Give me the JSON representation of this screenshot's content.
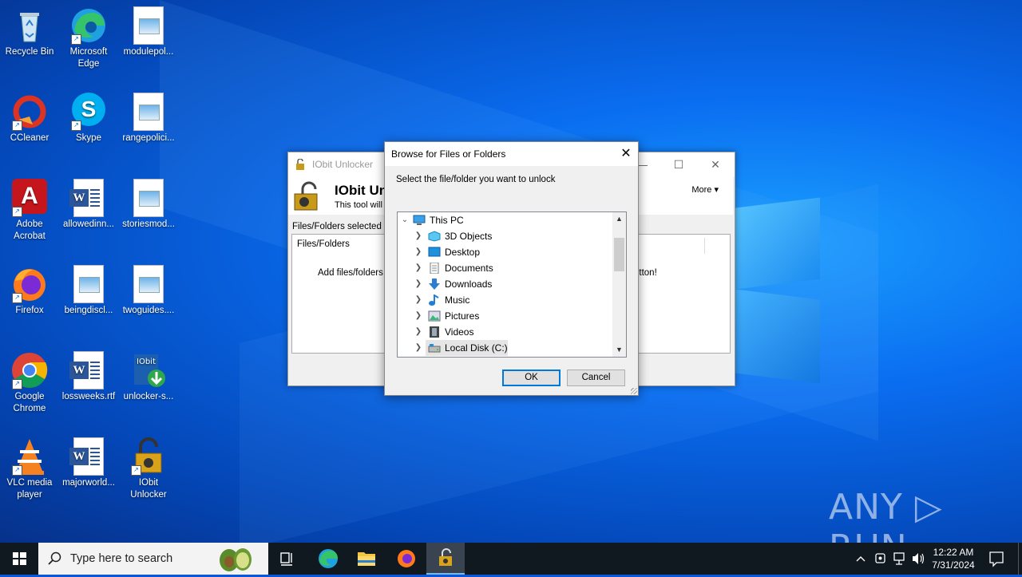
{
  "desktop": {
    "icons": [
      {
        "label": "Recycle Bin"
      },
      {
        "label": "Microsoft Edge"
      },
      {
        "label": "modulepol..."
      },
      {
        "label": "CCleaner"
      },
      {
        "label": "Skype"
      },
      {
        "label": "rangepolici..."
      },
      {
        "label": "Adobe Acrobat"
      },
      {
        "label": "allowedinn..."
      },
      {
        "label": "storiesmod..."
      },
      {
        "label": "Firefox"
      },
      {
        "label": "beingdiscl..."
      },
      {
        "label": "twoguides...."
      },
      {
        "label": "Google Chrome"
      },
      {
        "label": "lossweeks.rtf"
      },
      {
        "label": "unlocker-s..."
      },
      {
        "label": "VLC media player"
      },
      {
        "label": "majorworld..."
      },
      {
        "label": "IObit Unlocker"
      }
    ],
    "watermark": "ANY ▷ RUN"
  },
  "iobit_window": {
    "title": "IObit Unlocker",
    "app_title": "IObit Un",
    "app_subtitle": "This tool will h",
    "more_label": "More",
    "files_selected_label": "Files/Folders selected",
    "column_header": "Files/Folders",
    "hint_left": "Add files/folders t",
    "hint_right": "utton!"
  },
  "dialog": {
    "title": "Browse for Files or Folders",
    "prompt": "Select the file/folder you want to unlock",
    "tree": {
      "root": "This PC",
      "items": [
        {
          "label": "3D Objects",
          "icon": "3d-objects-icon"
        },
        {
          "label": "Desktop",
          "icon": "desktop-icon"
        },
        {
          "label": "Documents",
          "icon": "documents-icon"
        },
        {
          "label": "Downloads",
          "icon": "downloads-icon"
        },
        {
          "label": "Music",
          "icon": "music-icon"
        },
        {
          "label": "Pictures",
          "icon": "pictures-icon"
        },
        {
          "label": "Videos",
          "icon": "videos-icon"
        },
        {
          "label": "Local Disk (C:)",
          "icon": "local-disk-icon"
        }
      ]
    },
    "ok_label": "OK",
    "cancel_label": "Cancel"
  },
  "taskbar": {
    "search_placeholder": "Type here to search",
    "time": "12:22 AM",
    "date": "7/31/2024"
  }
}
